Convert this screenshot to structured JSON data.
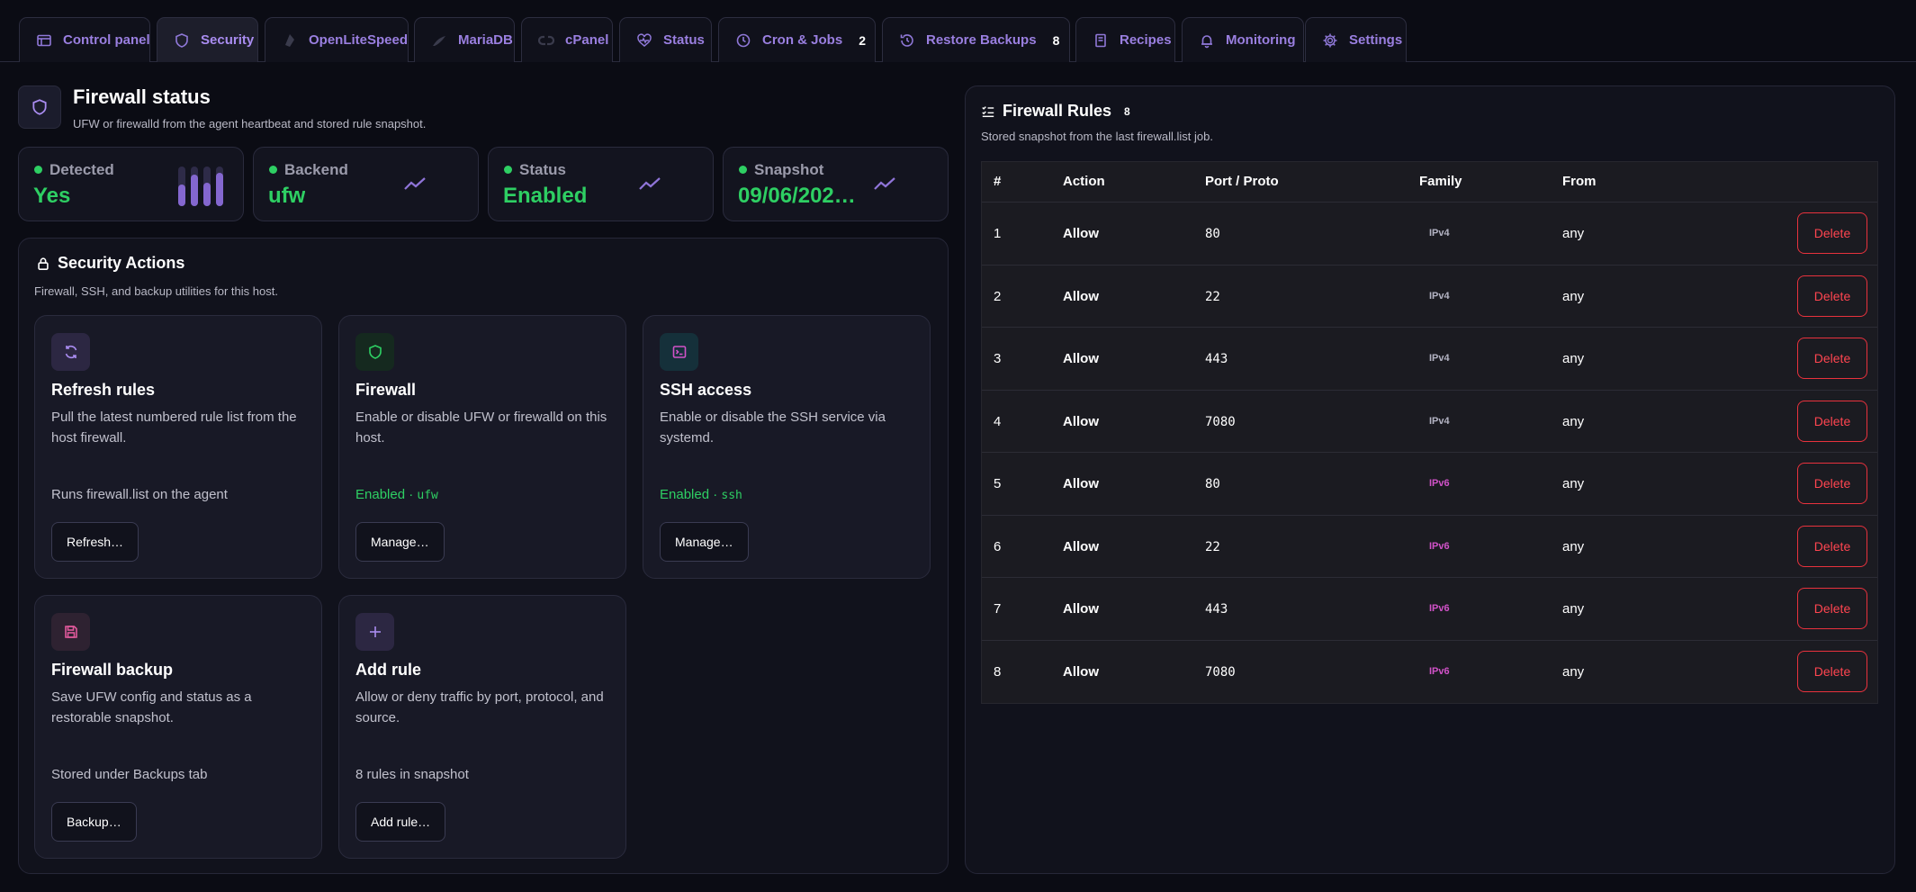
{
  "tabs": [
    {
      "label": "Control panel",
      "icon": "control-panel-icon",
      "active": false,
      "count": null
    },
    {
      "label": "Security",
      "icon": "shield-icon",
      "active": true,
      "count": null
    },
    {
      "label": "OpenLiteSpeed",
      "icon": "openlitespeed-icon",
      "active": false,
      "count": null
    },
    {
      "label": "MariaDB",
      "icon": "mariadb-icon",
      "active": false,
      "count": null
    },
    {
      "label": "cPanel",
      "icon": "cpanel-icon",
      "active": false,
      "count": null
    },
    {
      "label": "Status",
      "icon": "heart-pulse-icon",
      "active": false,
      "count": null
    },
    {
      "label": "Cron & Jobs",
      "icon": "clock-icon",
      "active": false,
      "count": "2"
    },
    {
      "label": "Restore Backups",
      "icon": "history-icon",
      "active": false,
      "count": "8"
    },
    {
      "label": "Recipes",
      "icon": "book-icon",
      "active": false,
      "count": null
    },
    {
      "label": "Monitoring",
      "icon": "bell-icon",
      "active": false,
      "count": null
    },
    {
      "label": "Settings",
      "icon": "gear-icon",
      "active": false,
      "count": null
    }
  ],
  "header": {
    "title": "Firewall status",
    "subtitle": "UFW or firewalld from the agent heartbeat and stored rule snapshot."
  },
  "stats": [
    {
      "label": "Detected",
      "value": "Yes",
      "indicator_color": "#2ecf63",
      "graphic": "bars",
      "bar_levels": [
        0.55,
        0.8,
        0.6,
        0.85
      ]
    },
    {
      "label": "Backend",
      "value": "ufw",
      "indicator_color": "#2ecf63",
      "graphic": "trend-icon"
    },
    {
      "label": "Status",
      "value": "Enabled",
      "indicator_color": "#2ecf63",
      "graphic": "trend-icon"
    },
    {
      "label": "Snapshot",
      "value": "09/06/202…",
      "indicator_color": "#2ecf63",
      "graphic": "trend-icon"
    }
  ],
  "security_actions": {
    "title": "Security Actions",
    "subtitle": "Firewall, SSH, and backup utilities for this host.",
    "cards": [
      {
        "title": "Refresh rules",
        "description": "Pull the latest numbered rule list from the host firewall.",
        "meta": "Runs firewall.list on the agent",
        "meta_code": "",
        "button": "Refresh…",
        "icon": "refresh-icon"
      },
      {
        "title": "Firewall",
        "description": "Enable or disable UFW or firewalld on this host.",
        "meta": "Enabled · ",
        "meta_code": "ufw",
        "button": "Manage…",
        "icon": "shield-icon"
      },
      {
        "title": "SSH access",
        "description": "Enable or disable the SSH service via systemd.",
        "meta": "Enabled · ",
        "meta_code": "ssh",
        "button": "Manage…",
        "icon": "terminal-icon"
      },
      {
        "title": "Firewall backup",
        "description": "Save UFW config and status as a restorable snapshot.",
        "meta": "Stored under Backups tab",
        "meta_code": "",
        "button": "Backup…",
        "icon": "save-icon"
      },
      {
        "title": "Add rule",
        "description": "Allow or deny traffic by port, protocol, and source.",
        "meta": "8 rules in snapshot",
        "meta_code": "",
        "button": "Add rule…",
        "icon": "plus-icon"
      }
    ]
  },
  "rules": {
    "title": "Firewall Rules",
    "count": "8",
    "subtitle": "Stored snapshot from the last firewall.list job.",
    "columns": [
      "#",
      "Action",
      "Port / Proto",
      "Family",
      "From"
    ],
    "delete_label": "Delete",
    "rows": [
      {
        "num": "1",
        "action": "Allow",
        "port": "80",
        "family": "IPv4",
        "from": "any"
      },
      {
        "num": "2",
        "action": "Allow",
        "port": "22",
        "family": "IPv4",
        "from": "any"
      },
      {
        "num": "3",
        "action": "Allow",
        "port": "443",
        "family": "IPv4",
        "from": "any"
      },
      {
        "num": "4",
        "action": "Allow",
        "port": "7080",
        "family": "IPv4",
        "from": "any"
      },
      {
        "num": "5",
        "action": "Allow",
        "port": "80",
        "family": "IPv6",
        "from": "any"
      },
      {
        "num": "6",
        "action": "Allow",
        "port": "22",
        "family": "IPv6",
        "from": "any"
      },
      {
        "num": "7",
        "action": "Allow",
        "port": "443",
        "family": "IPv6",
        "from": "any"
      },
      {
        "num": "8",
        "action": "Allow",
        "port": "7080",
        "family": "IPv6",
        "from": "any"
      }
    ]
  },
  "colors": {
    "accent": "#9a7fe0",
    "success": "#2ecf63",
    "danger": "#ff4550",
    "ipv6": "#d152c8",
    "background": "#0b0c14"
  }
}
